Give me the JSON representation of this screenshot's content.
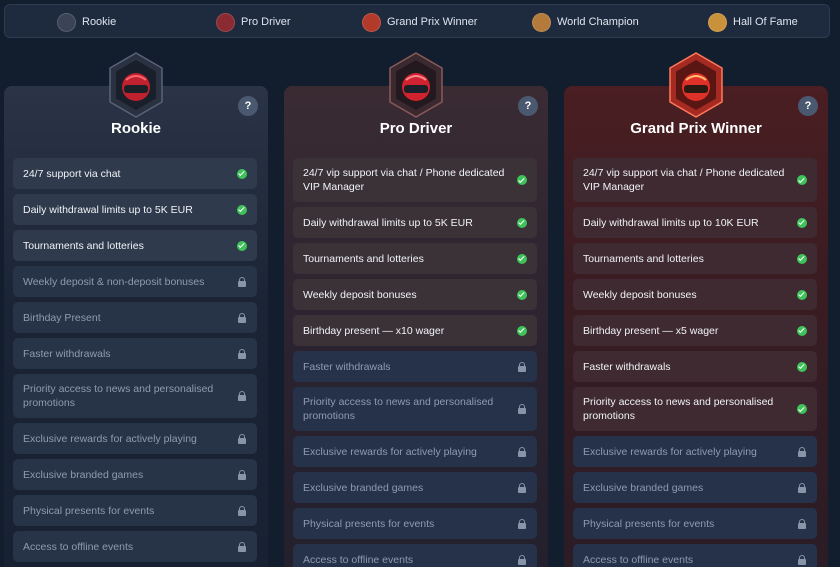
{
  "nav": {
    "items": [
      {
        "label": "Rookie",
        "icon": "helmet-icon",
        "color": "#3a4456"
      },
      {
        "label": "Pro Driver",
        "icon": "helmet-icon",
        "color": "#8a2a32"
      },
      {
        "label": "Grand Prix Winner",
        "icon": "helmet-icon",
        "color": "#b23a2a"
      },
      {
        "label": "World Champion",
        "icon": "helmet-icon",
        "color": "#b37a3a"
      },
      {
        "label": "Hall Of Fame",
        "icon": "helmet-icon",
        "color": "#c9913a"
      }
    ]
  },
  "tiers": [
    {
      "name": "Rookie",
      "help": "?",
      "accent": "#3a4456",
      "features": [
        {
          "text": "24/7 support via chat",
          "status": "check"
        },
        {
          "text": "Daily withdrawal limits up to 5K EUR",
          "status": "check"
        },
        {
          "text": "Tournaments and lotteries",
          "status": "check"
        },
        {
          "text": "Weekly deposit & non-deposit bonuses",
          "status": "lock"
        },
        {
          "text": "Birthday Present",
          "status": "lock"
        },
        {
          "text": "Faster withdrawals",
          "status": "lock"
        },
        {
          "text": "Priority access to news and personalised promotions",
          "status": "lock"
        },
        {
          "text": "Exclusive rewards for actively playing",
          "status": "lock"
        },
        {
          "text": "Exclusive branded games",
          "status": "lock"
        },
        {
          "text": "Physical presents for events",
          "status": "lock"
        },
        {
          "text": "Access to offline events",
          "status": "lock"
        }
      ]
    },
    {
      "name": "Pro Driver",
      "help": "?",
      "accent": "#8a2a32",
      "features": [
        {
          "text": "24/7 vip support via chat / Phone dedicated VIP Manager",
          "status": "check"
        },
        {
          "text": "Daily withdrawal limits up to 5K EUR",
          "status": "check"
        },
        {
          "text": "Tournaments and lotteries",
          "status": "check"
        },
        {
          "text": "Weekly deposit bonuses",
          "status": "check"
        },
        {
          "text": "Birthday present — x10 wager",
          "status": "check"
        },
        {
          "text": "Faster withdrawals",
          "status": "lock"
        },
        {
          "text": "Priority access to news and personalised promotions",
          "status": "lock"
        },
        {
          "text": "Exclusive rewards for actively playing",
          "status": "lock"
        },
        {
          "text": "Exclusive branded games",
          "status": "lock"
        },
        {
          "text": "Physical presents for events",
          "status": "lock"
        },
        {
          "text": "Access to offline events",
          "status": "lock"
        }
      ]
    },
    {
      "name": "Grand Prix Winner",
      "help": "?",
      "accent": "#b23a2a",
      "features": [
        {
          "text": "24/7 vip support via chat / Phone dedicated VIP Manager",
          "status": "check"
        },
        {
          "text": "Daily withdrawal limits up to 10K EUR",
          "status": "check"
        },
        {
          "text": "Tournaments and lotteries",
          "status": "check"
        },
        {
          "text": "Weekly deposit bonuses",
          "status": "check"
        },
        {
          "text": "Birthday present — x5 wager",
          "status": "check"
        },
        {
          "text": "Faster withdrawals",
          "status": "check"
        },
        {
          "text": "Priority access to news and personalised promotions",
          "status": "check"
        },
        {
          "text": "Exclusive rewards for actively playing",
          "status": "lock"
        },
        {
          "text": "Exclusive branded games",
          "status": "lock"
        },
        {
          "text": "Physical presents for events",
          "status": "lock"
        },
        {
          "text": "Access to offline events",
          "status": "lock"
        }
      ]
    }
  ]
}
